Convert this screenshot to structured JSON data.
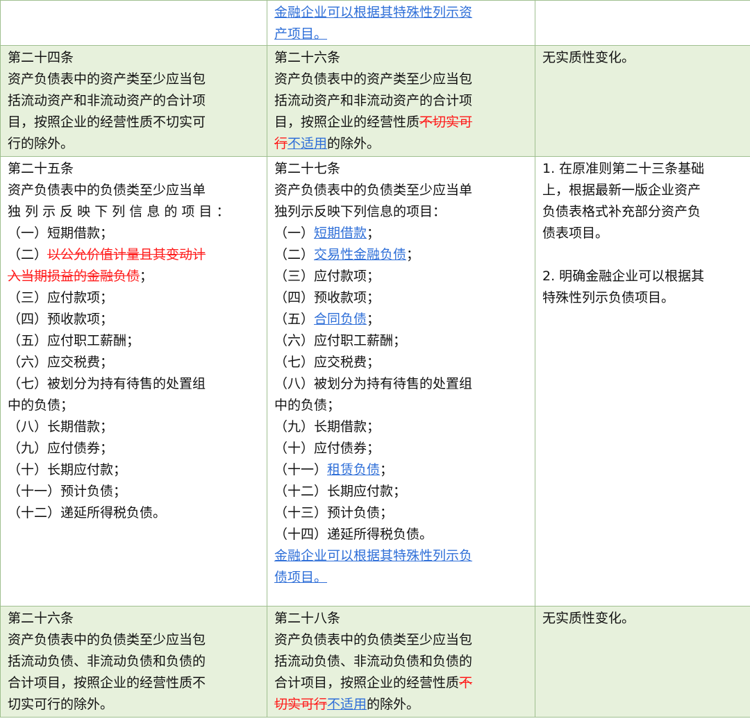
{
  "row0": {
    "mid_line1": "金融企业可以根据其特殊性列示资",
    "mid_line2": "产项目。"
  },
  "row1": {
    "old_heading": "第二十四条",
    "old_lines": [
      "资产负债表中的资产类至少应当包",
      "括流动资产和非流动资产的合计项",
      "目，按照企业的经营性质不切实可",
      "行的除外。"
    ],
    "new_heading": "第二十六条",
    "new_lines": [
      "资产负债表中的资产类至少应当包",
      "括流动资产和非流动资产的合计项"
    ],
    "new_line3_pre": "目，按照企业的经营性质",
    "new_line3_del": "不切实可",
    "new_line4_del": "行",
    "new_line4_ins": "不适用",
    "new_line4_post": "的除外。",
    "note": "无实质性变化。"
  },
  "row2": {
    "old_heading": "第二十五条",
    "old_intro1": "资产负债表中的负债类至少应当单",
    "old_intro2": "独 列 示 反 映 下 列 信 息 的 项 目 ：",
    "old_item1": "（一）短期借款；",
    "old_item2_prefix": "（二）",
    "old_item2_del1": "以公允价值计量且其变动计",
    "old_item2_del2": "入当期损益的金融负债",
    "old_item2_suffix": "；",
    "old_items_rest": [
      "（三）应付款项；",
      "（四）预收款项；",
      "（五）应付职工薪酬；",
      "（六）应交税费；",
      "（七）被划分为持有待售的处置组",
      "中的负债；",
      "（八）长期借款；",
      "（九）应付债券；",
      "（十）长期应付款；",
      "（十一）预计负债；",
      "（十二）递延所得税负债。"
    ],
    "new_heading": "第二十七条",
    "new_intro1": "资产负债表中的负债类至少应当单",
    "new_intro2": "独列示反映下列信息的项目：",
    "new_item1_prefix": "（一）",
    "new_item1_ins": "短期借款",
    "new_item1_suffix": "；",
    "new_item2_prefix": "（二）",
    "new_item2_ins": "交易性金融负债",
    "new_item2_suffix": "；",
    "new_item3": "（三）应付款项；",
    "new_item4": "（四）预收款项；",
    "new_item5_prefix": "（五）",
    "new_item5_ins": "合同负债",
    "new_item5_suffix": "；",
    "new_items_mid": [
      "（六）应付职工薪酬；",
      "（七）应交税费；",
      "（八）被划分为持有待售的处置组",
      "中的负债；",
      "（九）长期借款；",
      "（十）应付债券；"
    ],
    "new_item11_prefix": "（十一）",
    "new_item11_ins": "租赁负债",
    "new_item11_suffix": "；",
    "new_items_end": [
      "（十二）长期应付款；",
      "（十三）预计负债；",
      "（十四）递延所得税负债。"
    ],
    "new_tail1": "金融企业可以根据其特殊性列示负",
    "new_tail2": "债项目。",
    "note_lines1": [
      "1. 在原准则第二十三条基础",
      "上，根据最新一版企业资产",
      "负债表格式补充部分资产负",
      "债表项目。"
    ],
    "note_lines2": [
      "2. 明确金融企业可以根据其",
      "特殊性列示负债项目。"
    ]
  },
  "row3": {
    "old_heading": "第二十六条",
    "old_lines": [
      "资产负债表中的负债类至少应当包",
      "括流动负债、非流动负债和负债的",
      "合计项目，按照企业的经营性质不",
      "切实可行的除外。"
    ],
    "new_heading": "第二十八条",
    "new_lines": [
      "资产负债表中的负债类至少应当包",
      "括流动负债、非流动负债和负债的"
    ],
    "new_line3_pre": "合计项目，按照企业的经营性质",
    "new_line3_del": "不",
    "new_line4_del": "切实可行",
    "new_line4_ins": "不适用",
    "new_line4_post": "的除外。",
    "note": "无实质性变化。"
  }
}
